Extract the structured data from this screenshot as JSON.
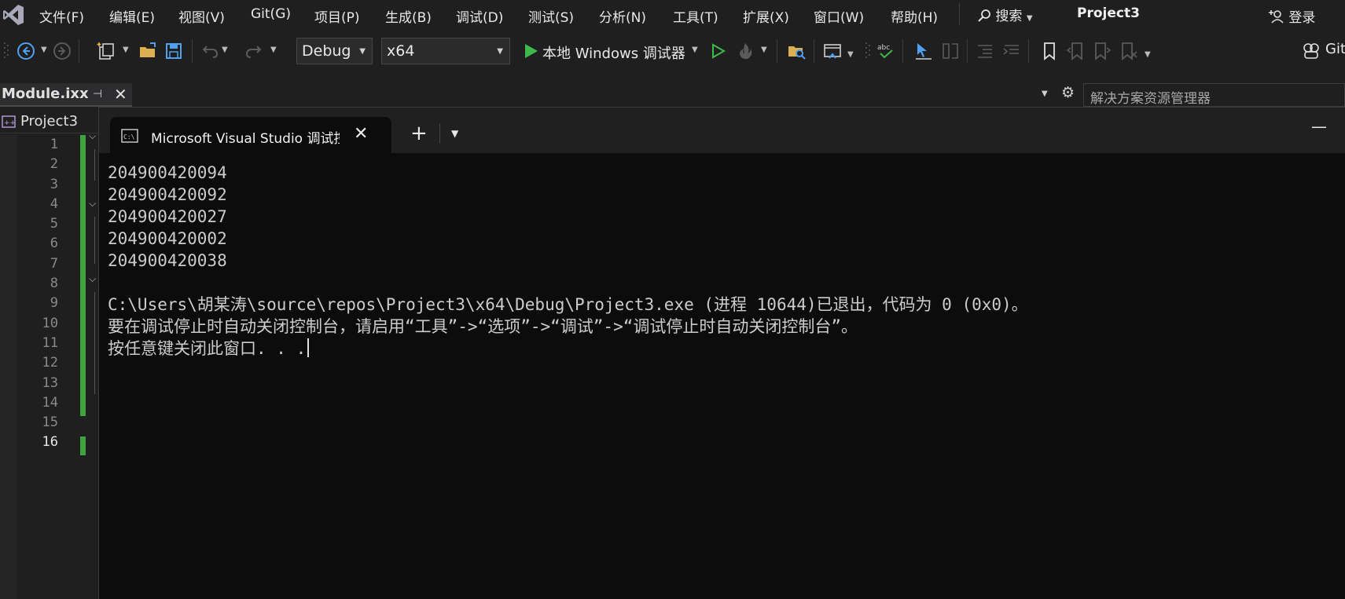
{
  "menubar": {
    "items": [
      "文件(F)",
      "编辑(E)",
      "视图(V)",
      "Git(G)",
      "项目(P)",
      "生成(B)",
      "调试(D)",
      "测试(S)",
      "分析(N)",
      "工具(T)",
      "扩展(X)",
      "窗口(W)",
      "帮助(H)"
    ],
    "search_label": "搜索",
    "project_title": "Project3",
    "login_label": "登录"
  },
  "toolbar": {
    "config_value": "Debug",
    "platform_value": "x64",
    "run_label": "本地 Windows 调试器",
    "git_label": "Git"
  },
  "doc_tab": {
    "label": "Module.ixx"
  },
  "solution_explorer": {
    "search_placeholder": "解决方案资源管理器"
  },
  "editor": {
    "nav_label": "Project3",
    "line_numbers": [
      "1",
      "2",
      "3",
      "4",
      "5",
      "6",
      "7",
      "8",
      "9",
      "10",
      "11",
      "12",
      "13",
      "14",
      "15",
      "16"
    ],
    "current_line": "16"
  },
  "console": {
    "tab_title": "Microsoft Visual Studio 调试控",
    "output_lines": [
      "204900420094",
      "204900420092",
      "204900420027",
      "204900420002",
      "204900420038",
      "",
      "C:\\Users\\胡某涛\\source\\repos\\Project3\\x64\\Debug\\Project3.exe (进程 10644)已退出，代码为 0 (0x0)。",
      "要在调试停止时自动关闭控制台，请启用“工具”->“选项”->“调试”->“调试停止时自动关闭控制台”。",
      "按任意键关闭此窗口. . ."
    ]
  },
  "colors": {
    "accent_green": "#3fa23f",
    "console_bg": "#0c0c0c",
    "ide_bg": "#1f1f1f"
  }
}
